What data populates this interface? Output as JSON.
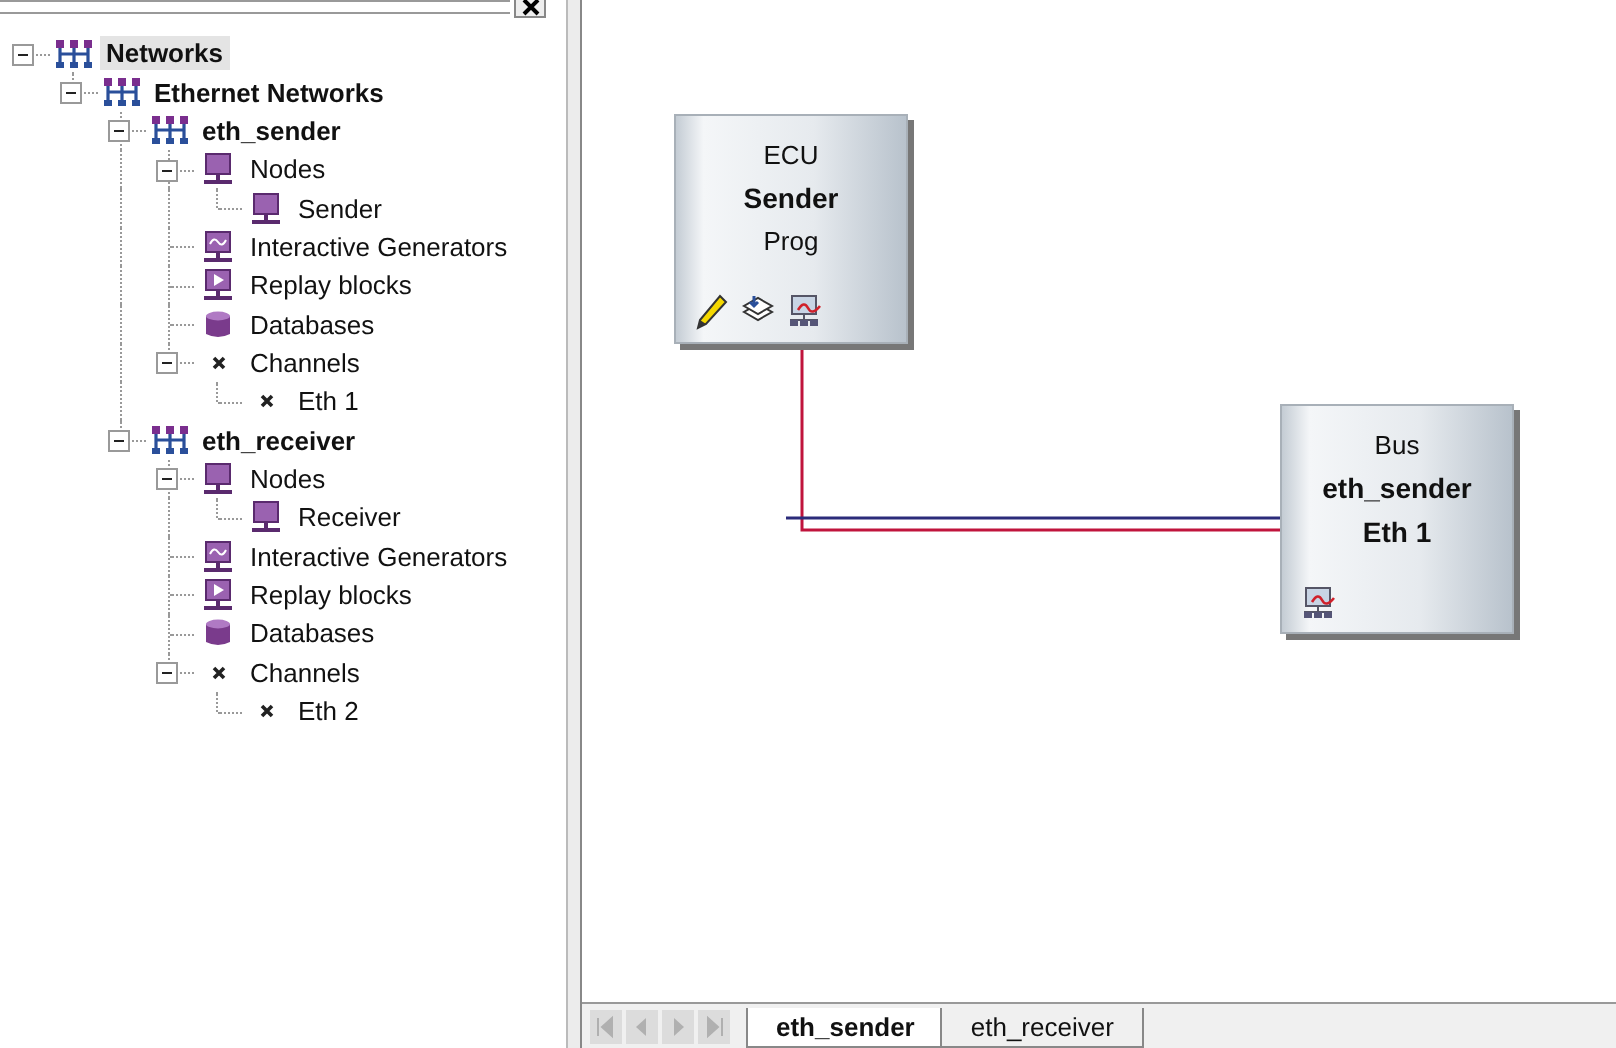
{
  "tree": [
    {
      "label": "Networks",
      "kind": "network",
      "selected": true,
      "expanded": true,
      "children": [
        {
          "label": "Ethernet Networks",
          "kind": "network",
          "selected": false,
          "expanded": true,
          "children": [
            {
              "label": "eth_sender",
              "kind": "network",
              "selected": false,
              "expanded": true,
              "children": [
                {
                  "label": "Nodes",
                  "kind": "node",
                  "selected": false,
                  "expanded": true,
                  "children": [
                    {
                      "label": "Sender",
                      "kind": "node",
                      "selected": false
                    }
                  ]
                },
                {
                  "label": "Interactive Generators",
                  "kind": "generator",
                  "selected": false
                },
                {
                  "label": "Replay blocks",
                  "kind": "replay",
                  "selected": false
                },
                {
                  "label": "Databases",
                  "kind": "database",
                  "selected": false
                },
                {
                  "label": "Channels",
                  "kind": "channel",
                  "selected": false,
                  "expanded": true,
                  "children": [
                    {
                      "label": "Eth 1",
                      "kind": "channel",
                      "selected": false
                    }
                  ]
                }
              ]
            },
            {
              "label": "eth_receiver",
              "kind": "network",
              "selected": false,
              "expanded": true,
              "children": [
                {
                  "label": "Nodes",
                  "kind": "node",
                  "selected": false,
                  "expanded": true,
                  "children": [
                    {
                      "label": "Receiver",
                      "kind": "node",
                      "selected": false
                    }
                  ]
                },
                {
                  "label": "Interactive Generators",
                  "kind": "generator",
                  "selected": false
                },
                {
                  "label": "Replay blocks",
                  "kind": "replay",
                  "selected": false
                },
                {
                  "label": "Databases",
                  "kind": "database",
                  "selected": false
                },
                {
                  "label": "Channels",
                  "kind": "channel",
                  "selected": false,
                  "expanded": true,
                  "children": [
                    {
                      "label": "Eth 2",
                      "kind": "channel",
                      "selected": false
                    }
                  ]
                }
              ]
            }
          ]
        }
      ]
    }
  ],
  "canvas": {
    "blocks": [
      {
        "kind": "ecu",
        "title": "ECU",
        "name": "Sender",
        "detail": "Prog"
      },
      {
        "kind": "bus",
        "title": "Bus",
        "name": "eth_sender",
        "detail": "Eth 1"
      }
    ]
  },
  "tabs": [
    {
      "label": "eth_sender",
      "selected": true
    },
    {
      "label": "eth_receiver",
      "selected": false
    }
  ]
}
